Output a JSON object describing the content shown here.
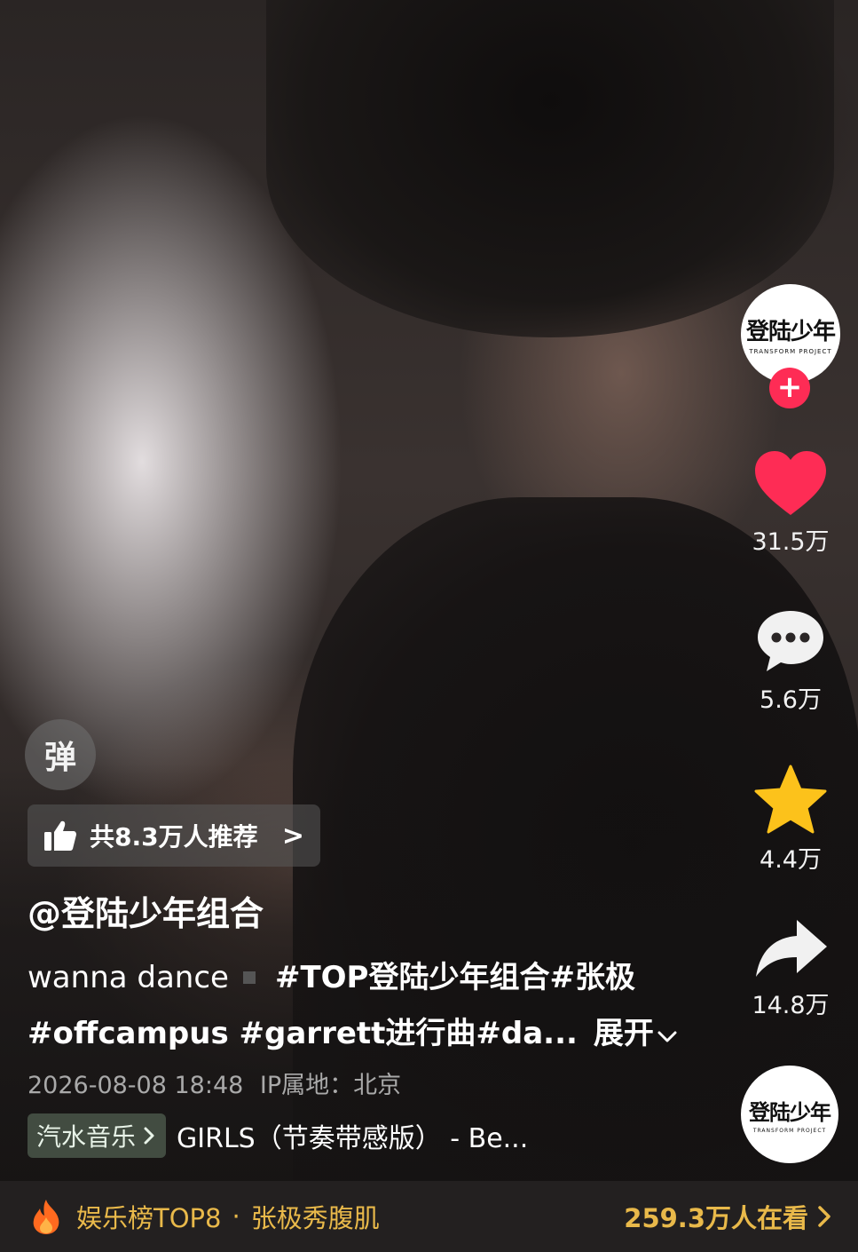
{
  "author": {
    "avatar_logo": "登陆少年",
    "avatar_logo_sub": "TRANSFORM PROJECT",
    "handle": "@登陆少年组合",
    "follow_symbol": "+"
  },
  "actions": {
    "likes": "31.5万",
    "comments": "5.6万",
    "favorites": "4.4万",
    "shares": "14.8万"
  },
  "danmu_label": "弹",
  "recommend_text": "共8.3万人推荐",
  "recommend_chevron": ">",
  "description": {
    "line1_text": "wanna dance",
    "line1_tags": "#TOP登陆少年组合#张极",
    "line2_tags": "#offcampus #garrett进行曲#da...",
    "expand_label": "展开"
  },
  "meta": {
    "datetime": "2026-08-08 18:48",
    "ip_location": "IP属地：北京"
  },
  "music": {
    "source_label": "汽水音乐",
    "title": "GIRLS（节奏带感版） - Be..."
  },
  "music_disc_logo": "登陆少年",
  "music_disc_sub": "TRANSFORM PROJECT",
  "bottom_bar": {
    "rank": "娱乐榜TOP8",
    "separator": "·",
    "topic": "张极秀腹肌",
    "watching": "259.3万人在看"
  },
  "colors": {
    "like_red": "#fe2c55",
    "star_yellow": "#fcc21b",
    "bottom_accent": "#e9b94a"
  },
  "icons": [
    "heart-icon",
    "comment-icon",
    "star-icon",
    "share-icon",
    "thumbs-up-icon",
    "flame-icon",
    "chevron-right-icon",
    "chevron-down-icon"
  ]
}
